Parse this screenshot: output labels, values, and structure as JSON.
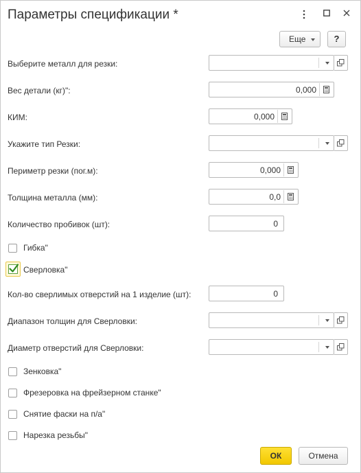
{
  "window": {
    "title": "Параметры спецификации *",
    "menu_icon": "kebab-menu-icon",
    "maximize_icon": "maximize-icon",
    "close_icon": "close-icon"
  },
  "toolbar": {
    "more_label": "Еще",
    "help_label": "?"
  },
  "fields": {
    "metal": {
      "label": "Выберите металл для резки:",
      "value": ""
    },
    "weight": {
      "label": "Вес детали (кг)\":",
      "value": "0,000"
    },
    "kim": {
      "label": "КИМ:",
      "value": "0,000"
    },
    "cut_type": {
      "label": "Укажите тип Резки:",
      "value": ""
    },
    "perimeter": {
      "label": "Периметр резки (пог.м):",
      "value": "0,000"
    },
    "thickness": {
      "label": "Толщина металла (мм):",
      "value": "0,0"
    },
    "piercings": {
      "label": "Количество пробивок (шт):",
      "value": "0"
    },
    "holes_count": {
      "label": "Кол-во сверлимых отверстий на 1 изделие (шт):",
      "value": "0"
    },
    "drill_range": {
      "label": "Диапазон толщин для Сверловки:",
      "value": ""
    },
    "drill_diameter": {
      "label": "Диаметр отверстий для Сверловки:",
      "value": ""
    }
  },
  "checkboxes": {
    "bending": {
      "label": "Гибка\"",
      "checked": false
    },
    "drilling": {
      "label": "Сверловка\"",
      "checked": true
    },
    "countersink": {
      "label": "Зенковка\"",
      "checked": false
    },
    "milling": {
      "label": "Фрезеровка на фрейзерном станке\"",
      "checked": false
    },
    "chamfer": {
      "label": "Снятие фаски на п/а\"",
      "checked": false
    },
    "threading": {
      "label": "Нарезка резьбы\"",
      "checked": false
    }
  },
  "footer": {
    "ok_label": "ОК",
    "cancel_label": "Отмена"
  },
  "colors": {
    "accent": "#f2c800",
    "check": "#2f8a1e"
  }
}
